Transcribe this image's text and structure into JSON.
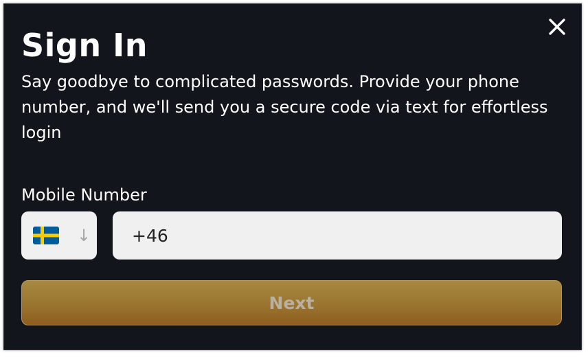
{
  "dialog": {
    "title": "Sign In",
    "subtitle": "Say goodbye to complicated passwords. Provide your phone number, and we'll send you a secure code via text for effortless login",
    "close_icon": "close-icon"
  },
  "form": {
    "mobile_label": "Mobile Number",
    "country": {
      "flag_icon": "sweden-flag-icon",
      "dropdown_glyph": "↓"
    },
    "phone_value": "+46",
    "next_label": "Next"
  },
  "colors": {
    "dialog_background": "#12151c",
    "input_background": "#f0f0f0",
    "button_gradient_top": "#a78940",
    "button_gradient_bottom": "#8e5e1f",
    "button_text": "#b9b0a2",
    "flag_blue": "#005b99",
    "flag_yellow": "#fecb00"
  }
}
